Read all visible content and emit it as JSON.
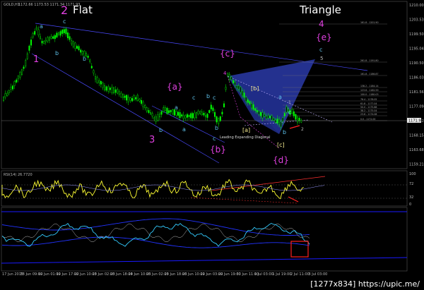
{
  "header": {
    "symbol_info": "GOLD,H1",
    "ohlc": "1172.66 1173.53 1171.34 1171.93"
  },
  "annotations": {
    "flat_number": "2",
    "flat_word": "Flat",
    "triangle_word": "Triangle",
    "triangle_number": "4",
    "leading_diagonal": "Leading Expanding Diagonal"
  },
  "waves": [
    {
      "text": "1",
      "color": "#e040e0",
      "size": 13
    },
    {
      "text": "a",
      "color": "#5ec0e8",
      "size": 8
    },
    {
      "text": "c",
      "color": "#5ec0e8",
      "size": 8
    },
    {
      "text": "b",
      "color": "#5ec0e8",
      "size": 8
    },
    {
      "text": "b",
      "color": "#5ec0e8",
      "size": 8
    },
    {
      "text": "{a}",
      "color": "#e040e0",
      "size": 12
    },
    {
      "text": "a",
      "color": "#5ec0e8",
      "size": 8
    },
    {
      "text": "c",
      "color": "#5ec0e8",
      "size": 8
    },
    {
      "text": "b",
      "color": "#5ec0e8",
      "size": 8
    },
    {
      "text": "a",
      "color": "#5ec0e8",
      "size": 8
    },
    {
      "text": "b",
      "color": "#5ec0e8",
      "size": 8
    },
    {
      "text": "3",
      "color": "#e040e0",
      "size": 13
    },
    {
      "text": "b",
      "color": "#5ec0e8",
      "size": 8
    },
    {
      "text": "c",
      "color": "#5ec0e8",
      "size": 8
    },
    {
      "text": "c",
      "color": "#5ec0e8",
      "size": 8
    },
    {
      "text": "{b}",
      "color": "#e040e0",
      "size": 12
    },
    {
      "text": "{c}",
      "color": "#e040e0",
      "size": 12
    },
    {
      "text": "[b]",
      "color": "#f0e68c",
      "size": 8
    },
    {
      "text": "[a]",
      "color": "#f0e68c",
      "size": 8
    },
    {
      "text": "a",
      "color": "#5ec0e8",
      "size": 8
    },
    {
      "text": "b",
      "color": "#5ec0e8",
      "size": 8
    },
    {
      "text": "c",
      "color": "#5ec0e8",
      "size": 8
    },
    {
      "text": "[c]",
      "color": "#f0e68c",
      "size": 8
    },
    {
      "text": "{d}",
      "color": "#e040e0",
      "size": 12
    },
    {
      "text": "{e}",
      "color": "#e040e0",
      "size": 12
    },
    {
      "text": "c",
      "color": "#5ec0e8",
      "size": 8
    },
    {
      "text": "5",
      "color": "#bbbbbb",
      "size": 7
    },
    {
      "text": "4",
      "color": "#e040e0",
      "size": 7
    },
    {
      "text": "2",
      "color": "#bbbbbb",
      "size": 6
    },
    {
      "text": "1",
      "color": "#bbbbbb",
      "size": 6
    }
  ],
  "fib_levels": [
    "161.8 - 1201.90",
    "261.8 - 1191.80",
    "161.8 - 1186.87",
    "138.2 - 1184.14",
    "123.6 - 1182.59",
    "100.0 - 1180.03",
    "76.4 - 1178.05",
    "61.8 - 1177.04",
    "50.0 - 1175.88",
    "38.2 - 1175.04",
    "23.6 - 1174.08",
    "0.0 - 1172.00"
  ],
  "price_axis": [
    "1210.00",
    "1203.53",
    "1199.50",
    "1195.04",
    "1190.50",
    "1186.03",
    "1181.56",
    "1177.09",
    "1172.62",
    "1168.15",
    "1163.68",
    "1159.21"
  ],
  "current_price": "1171.93",
  "rsi": {
    "title": "RSI(14) 26.7720",
    "axis": [
      "100",
      "72",
      "32",
      "0"
    ]
  },
  "time_axis": [
    "17 Jun 2015",
    "18 Jun 09:00",
    "19 Jun 01:00",
    "19 Jun 17:00",
    "22 Jun 10:00",
    "23 Jun 02:00",
    "23 Jun 18:00",
    "24 Jun 10:00",
    "25 Jun 02:00",
    "25 Jun 18:00",
    "26 Jun 10:00",
    "29 Jun 03:00",
    "29 Jun 19:00",
    "30 Jun 11:00",
    "1 Jul 03:00",
    "1 Jul 19:00",
    "2 Jul 11:00",
    "3 Jul 03:00"
  ],
  "watermark": "[1277x834] https://upic.me/",
  "colors": {
    "candle": "#00ff00",
    "channel": "#4444ff",
    "triangle": "#3340c0",
    "rsi_line": "#ffff33",
    "osc_line": "#33ccff",
    "highlight_box": "#ff2020"
  }
}
